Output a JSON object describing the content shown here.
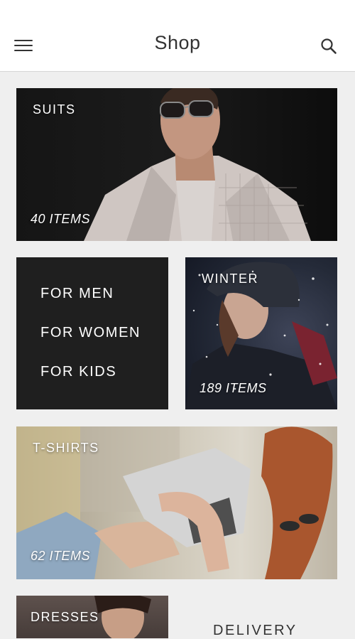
{
  "header": {
    "title": "Shop",
    "menu_icon": "hamburger-menu-icon",
    "search_icon": "search-icon"
  },
  "tiles": {
    "suits": {
      "label": "SUITS",
      "count": "40 ITEMS"
    },
    "winter": {
      "label": "WINTER",
      "count": "189 ITEMS"
    },
    "tshirts": {
      "label": "T-SHIRTS",
      "count": "62 ITEMS"
    },
    "dresses": {
      "label": "DRESSES"
    }
  },
  "categories": [
    {
      "label": "FOR MEN"
    },
    {
      "label": "FOR WOMEN"
    },
    {
      "label": "FOR KIDS"
    }
  ],
  "delivery_label": "DELIVERY",
  "colors": {
    "header_bg": "#ffffff",
    "page_bg": "#efefef",
    "category_box_bg": "#1f1f1f",
    "text_dark": "#333333"
  }
}
